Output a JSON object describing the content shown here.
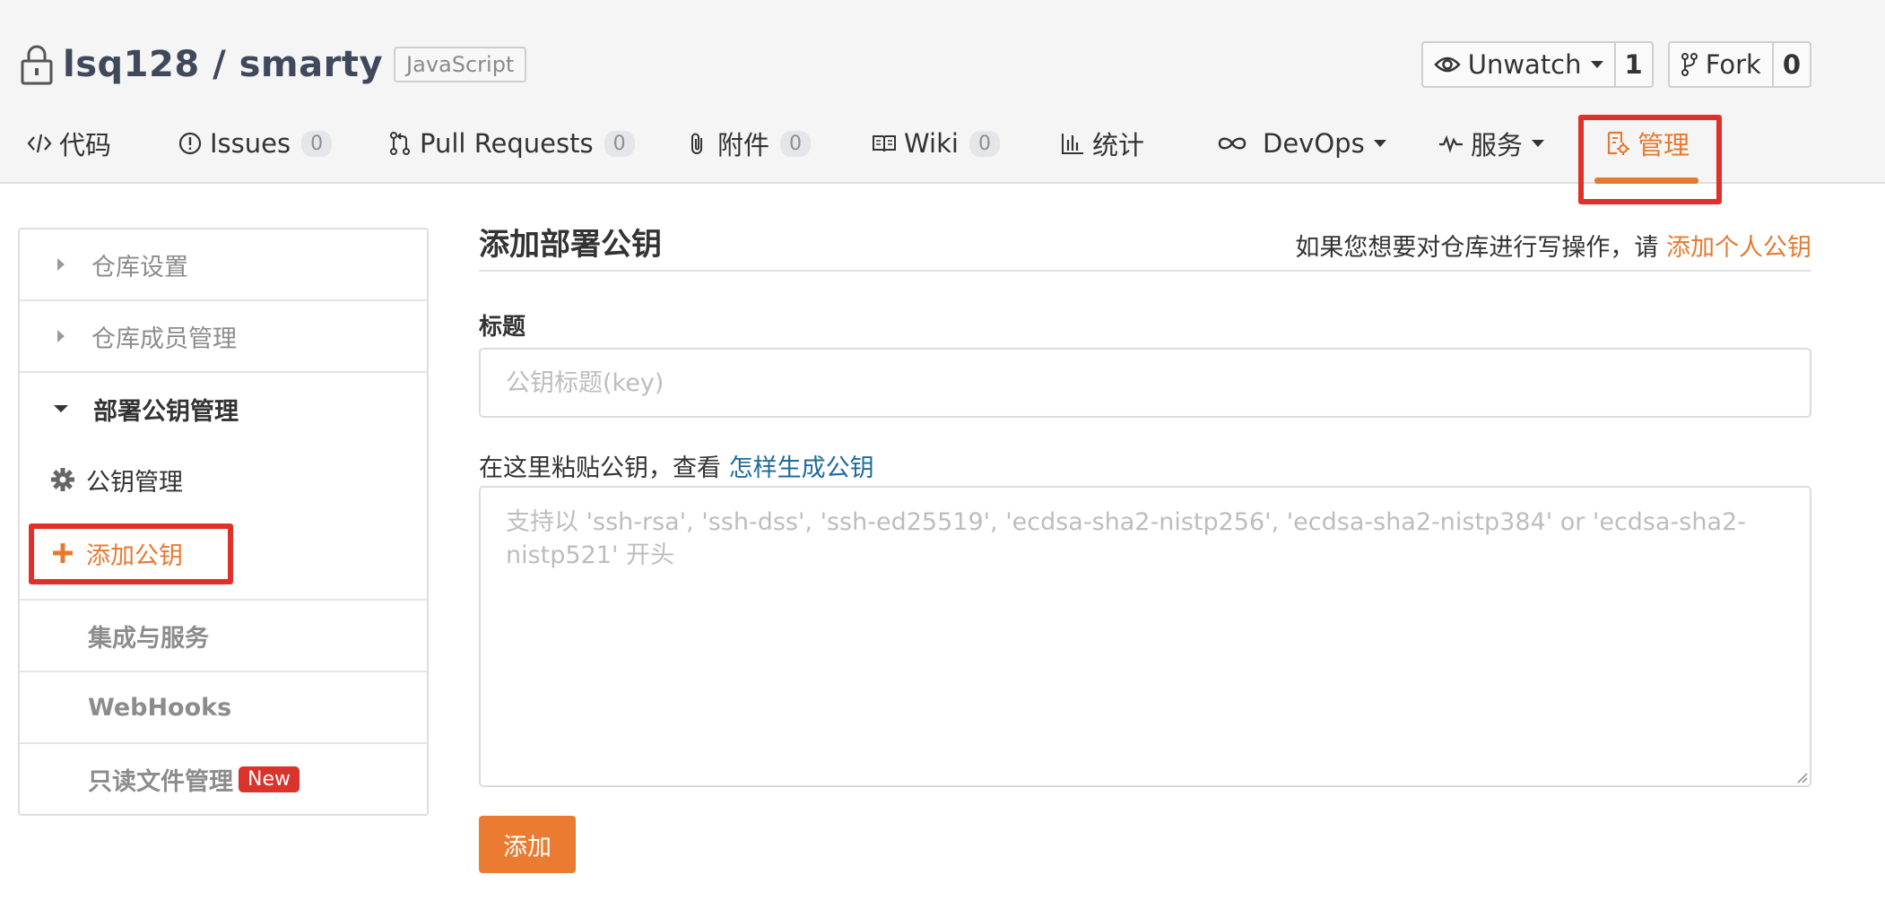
{
  "repo": {
    "owner": "lsq128",
    "separator": " / ",
    "name": "smarty",
    "language": "JavaScript"
  },
  "actions": {
    "watch_label": "Unwatch",
    "watch_count": "1",
    "fork_label": "Fork",
    "fork_count": "0"
  },
  "tabs": [
    {
      "label": "代码",
      "icon": "code-icon"
    },
    {
      "label": "Issues",
      "count": "0",
      "icon": "issue-icon"
    },
    {
      "label": "Pull Requests",
      "count": "0",
      "icon": "pull-request-icon"
    },
    {
      "label": "附件",
      "count": "0",
      "icon": "paperclip-icon"
    },
    {
      "label": "Wiki",
      "count": "0",
      "icon": "book-icon"
    },
    {
      "label": "统计",
      "icon": "bar-chart-icon"
    },
    {
      "label": "DevOps",
      "icon": "infinity-icon"
    },
    {
      "label": "服务",
      "icon": "pulse-icon"
    },
    {
      "label": "管理",
      "icon": "settings-doc-icon",
      "active": true
    }
  ],
  "sidebar": {
    "repo_settings": "仓库设置",
    "member_management": "仓库成员管理",
    "deploy_key_section": "部署公钥管理",
    "key_management": "公钥管理",
    "add_key": "添加公钥",
    "integrations": "集成与服务",
    "webhooks": "WebHooks",
    "readonly_files": "只读文件管理",
    "new_badge": "New"
  },
  "main": {
    "title": "添加部署公钥",
    "hint_text": "如果您想要对仓库进行写操作，请",
    "hint_link": "添加个人公钥",
    "title_label": "标题",
    "title_placeholder": "公钥标题(key)",
    "paste_text": "在这里粘贴公钥，查看",
    "paste_link": "怎样生成公钥",
    "key_placeholder": "支持以 'ssh-rsa', 'ssh-dss', 'ssh-ed25519', 'ecdsa-sha2-nistp256', 'ecdsa-sha2-nistp384' or 'ecdsa-sha2-nistp521' 开头",
    "submit_label": "添加"
  },
  "colors": {
    "accent": "#e8792f",
    "highlight": "#e0302a",
    "link": "#1f6b9c",
    "badge": "#d9332b"
  }
}
